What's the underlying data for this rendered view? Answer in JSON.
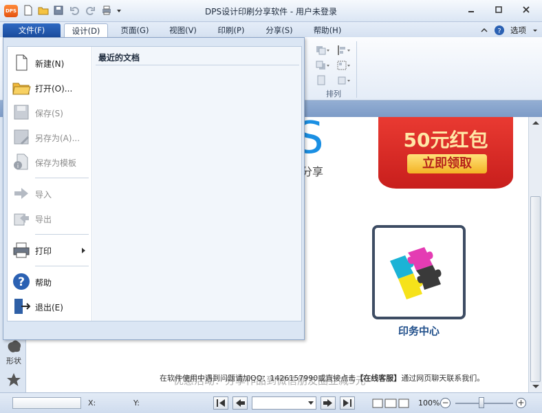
{
  "window": {
    "logo": "DPS",
    "title": "DPS设计印刷分享软件 - 用户未登录"
  },
  "tabs": {
    "file": "文件(F)",
    "design": "设计(D)",
    "page": "页面(G)",
    "view": "视图(V)",
    "print": "印刷(P)",
    "share": "分享(S)",
    "help": "帮助(H)",
    "options": "选项"
  },
  "ribbon": {
    "group_arrange": "排列"
  },
  "file_menu": {
    "recent_title": "最近的文档",
    "items": [
      {
        "label": "新建(N)",
        "icon": "new-document-icon",
        "enabled": true
      },
      {
        "label": "打开(O)...",
        "icon": "open-folder-icon",
        "enabled": true
      },
      {
        "label": "保存(S)",
        "icon": "save-icon",
        "enabled": false
      },
      {
        "label": "另存为(A)...",
        "icon": "save-as-icon",
        "enabled": false
      },
      {
        "label": "保存为模板",
        "icon": "save-template-icon",
        "enabled": false
      },
      {
        "label": "导入",
        "icon": "import-icon",
        "enabled": false
      },
      {
        "label": "导出",
        "icon": "export-icon",
        "enabled": false
      },
      {
        "label": "打印",
        "icon": "printer-icon",
        "enabled": true
      },
      {
        "label": "帮助",
        "icon": "help-icon",
        "enabled": true
      },
      {
        "label": "退出(E)",
        "icon": "exit-icon",
        "enabled": true
      }
    ]
  },
  "canvas": {
    "big_letter": "S",
    "share_text": "分享",
    "redpack_title": "50元红包",
    "redpack_button": "立即领取",
    "tile_label": "印务中心",
    "shape_label": "形状",
    "notice_prefix": "在软件使用中遇到问题请加QQ：1426157990或直接点击",
    "notice_link": "【在线客服】",
    "notice_suffix": "通过网页聊天联系我们。",
    "promo": "优惠活动：分享作品到微信朋友圈立减5元"
  },
  "statusbar": {
    "x_label": "X:",
    "y_label": "Y:",
    "zoom": "100%"
  },
  "colors": {
    "file_tab": "#1a4c9d",
    "red_packet": "#d5271f",
    "accent_blue": "#1a8fe3"
  }
}
